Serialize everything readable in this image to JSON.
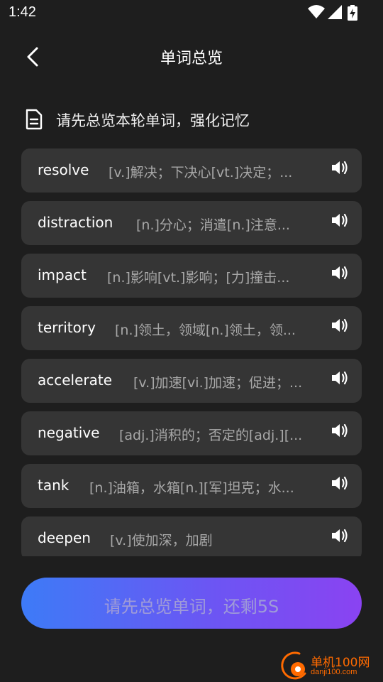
{
  "status_bar": {
    "time": "1:42",
    "icons": [
      "wifi-icon",
      "cell-signal-icon",
      "battery-charging-icon"
    ]
  },
  "header": {
    "title": "单词总览",
    "back_icon": "back-arrow-icon"
  },
  "hint": {
    "icon": "document-icon",
    "text": "请先总览本轮单词，强化记忆"
  },
  "words": [
    {
      "word": "resolve",
      "definition": "[v.]解决；下决心[vt.]决定；..."
    },
    {
      "word": "distraction",
      "definition": "[n.]分心；消遣[n.]注意..."
    },
    {
      "word": "impact",
      "definition": "[n.]影响[vt.]影响；[力]撞击..."
    },
    {
      "word": "territory",
      "definition": "[n.]领土，领域[n.]领土，领..."
    },
    {
      "word": "accelerate",
      "definition": "[v.]加速[vi.]加速；促进；..."
    },
    {
      "word": "negative",
      "definition": "[adj.]消积的；否定的[adj.][..."
    },
    {
      "word": "tank",
      "definition": "[n.]油箱，水箱[n.][军]坦克；水..."
    },
    {
      "word": "deepen",
      "definition": "[v.]使加深，加剧"
    }
  ],
  "cta": {
    "label": "请先总览单词，还剩5S"
  },
  "watermark": {
    "brand": "单机100网",
    "url": "danji100.com"
  },
  "colors": {
    "background": "#1e1e1e",
    "card": "#353535",
    "definition_text": "#a8a8a8",
    "gradient_start": "#3d7bf7",
    "gradient_end": "#8a43f2",
    "watermark": "#ff6a00"
  }
}
